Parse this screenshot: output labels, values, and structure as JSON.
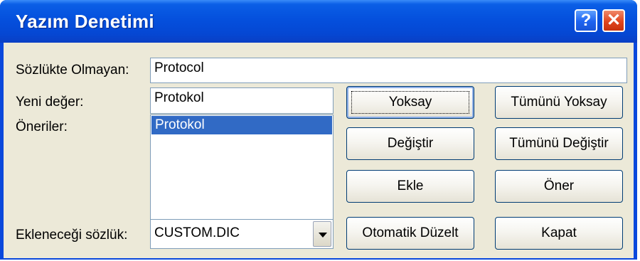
{
  "window": {
    "title": "Yazım Denetimi"
  },
  "titlebar": {
    "help_glyph": "?",
    "close_glyph": "✕"
  },
  "not_in_dictionary": {
    "label": "Sözlükte Olmayan:",
    "value": "Protocol"
  },
  "change_to": {
    "label": "Yeni değer:",
    "value": "Protokol"
  },
  "suggestions": {
    "label": "Öneriler:",
    "items": [
      "Protokol"
    ]
  },
  "add_words_to": {
    "label": "Ekleneceği sözlük:",
    "value": "CUSTOM.DIC"
  },
  "buttons": {
    "ignore": "Yoksay",
    "ignore_all": "Tümünü Yoksay",
    "change": "Değiştir",
    "change_all": "Tümünü Değiştir",
    "add": "Ekle",
    "suggest": "Öner",
    "autocorrect": "Otomatik Düzelt",
    "close": "Kapat"
  },
  "colors": {
    "titlebar": "#0550dd",
    "dialog_face": "#ece9d8",
    "selection": "#316ac5",
    "close_button": "#e0451e"
  }
}
